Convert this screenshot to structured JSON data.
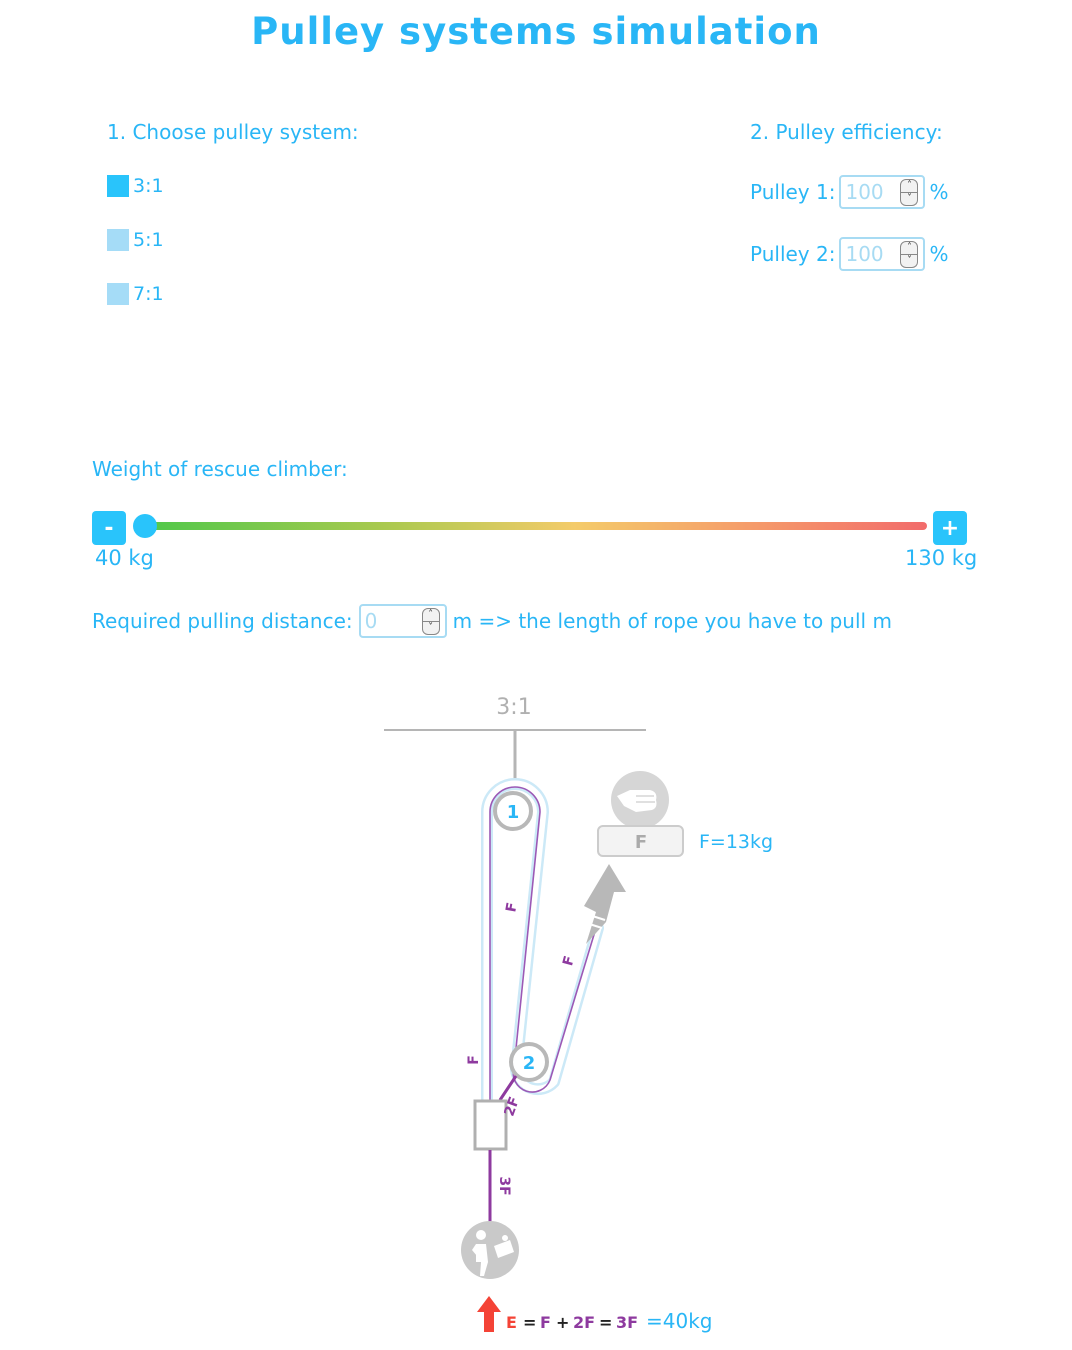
{
  "title": "Pulley systems simulation",
  "system": {
    "heading": "1. Choose pulley system:",
    "options": [
      {
        "label": "3:1",
        "selected": true
      },
      {
        "label": "5:1",
        "selected": false
      },
      {
        "label": "7:1",
        "selected": false
      }
    ]
  },
  "efficiency": {
    "heading": "2. Pulley efficiency:",
    "pulley1_label": "Pulley 1:",
    "pulley1_value": "100",
    "pulley2_label": "Pulley 2:",
    "pulley2_value": "100",
    "unit": "%"
  },
  "weight": {
    "heading": "Weight of rescue climber:",
    "minus_label": "-",
    "plus_label": "+",
    "min_label": "40 kg",
    "max_label": "130 kg",
    "min": 40,
    "max": 130,
    "value": 40
  },
  "distance": {
    "label": "Required pulling distance:",
    "value": "0",
    "suffix": "m => the length of rope you have to pull m"
  },
  "diagram": {
    "ratio_label": "3:1",
    "pulley1_number": "1",
    "pulley2_number": "2",
    "hand_box_label": "F",
    "force_label": "F=13kg",
    "rope_label_f": "F",
    "rope_label_2f": "2F",
    "rope_label_3f": "3F",
    "eq_e": "E",
    "eq_eq1": "=",
    "eq_f": "F",
    "eq_plus1": "+",
    "eq_2f": "2F",
    "eq_plus2": "=",
    "eq_3f": "3F",
    "eq_result": "=40kg",
    "colors": {
      "accent": "#29b6f6",
      "rope_label": "#8e3a9f",
      "arrow": "#f44336",
      "gray": "#b0b0b0"
    }
  }
}
